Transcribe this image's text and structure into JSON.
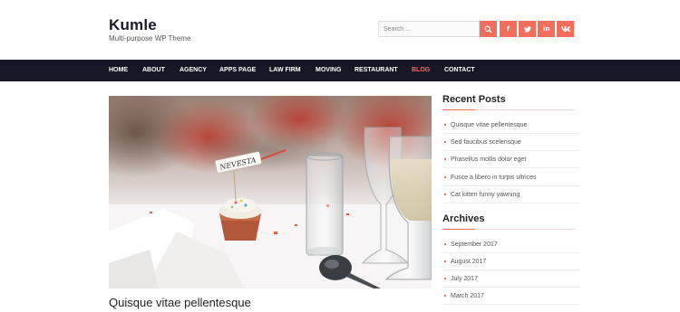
{
  "site": {
    "title": "Kumle",
    "description": "Multi-purpose WP Theme"
  },
  "search": {
    "placeholder": "Search ..."
  },
  "social": {
    "facebook_glyph": "f",
    "linkedin_glyph": "in"
  },
  "nav": {
    "items": [
      {
        "label": "HOME"
      },
      {
        "label": "ABOUT"
      },
      {
        "label": "AGENCY"
      },
      {
        "label": "APPS PAGE"
      },
      {
        "label": "LAW FIRM"
      },
      {
        "label": "MOVING"
      },
      {
        "label": "RESTAURANT"
      },
      {
        "label": "BLOG"
      },
      {
        "label": "CONTACT"
      }
    ],
    "active": "BLOG"
  },
  "post": {
    "image_tag_text": "NEVESTA",
    "title": "Quisque vitae pellentesque"
  },
  "sidebar": {
    "recent": {
      "title": "Recent Posts",
      "items": [
        {
          "label": "Quisque vitae pellentesque"
        },
        {
          "label": "Sed faucibus scelerisque"
        },
        {
          "label": "Phasellus mollis dolor eget"
        },
        {
          "label": "Fusce a libero in turpis ultrices"
        },
        {
          "label": "Cat kitten funny yawning"
        }
      ]
    },
    "archives": {
      "title": "Archives",
      "items": [
        {
          "label": "September 2017"
        },
        {
          "label": "August 2017"
        },
        {
          "label": "July 2017"
        },
        {
          "label": "March 2017"
        }
      ]
    }
  },
  "colors": {
    "accent": "#f26d5b",
    "nav_bg": "#161625"
  }
}
